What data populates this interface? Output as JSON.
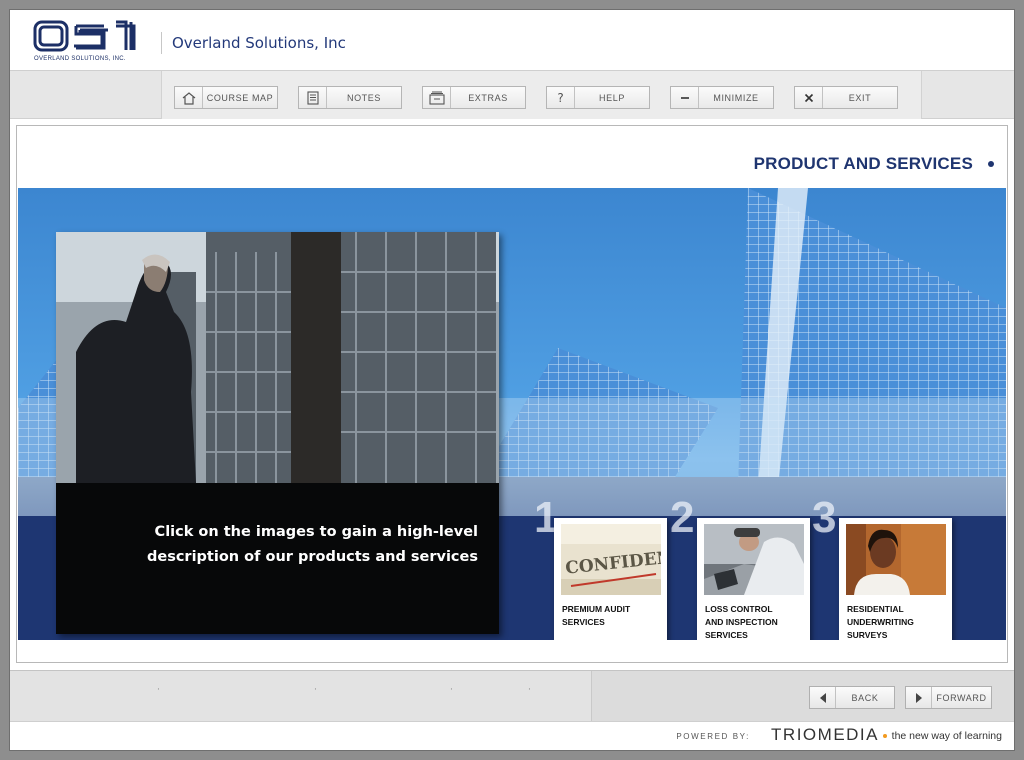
{
  "header": {
    "logo_text": "OSI",
    "logo_subtitle": "OVERLAND SOLUTIONS, INC.",
    "company_name": "Overland Solutions, Inc"
  },
  "toolbar": {
    "course_map": "COURSE MAP",
    "notes": "NOTES",
    "extras": "EXTRAS",
    "help": "HELP",
    "minimize": "MINIMIZE",
    "exit": "EXIT"
  },
  "main": {
    "section_title": "PRODUCT AND SERVICES",
    "intro_line1": "Click on the images to gain a high-level",
    "intro_line2": "description of our products and services",
    "cards": [
      {
        "number": "1",
        "line1": "PREMIUM AUDIT",
        "line2": "SERVICES",
        "line3": "",
        "image_text": "CONFIDEN"
      },
      {
        "number": "2",
        "line1": "LOSS CONTROL",
        "line2": "AND INSPECTION",
        "line3": "SERVICES"
      },
      {
        "number": "3",
        "line1": "RESIDENTIAL",
        "line2": "UNDERWRITING",
        "line3": "SURVEYS"
      }
    ]
  },
  "footer": {
    "back": "BACK",
    "forward": "FORWARD",
    "powered_by": "POWERED BY:",
    "brand": "TRIOMEDIA",
    "tagline": "the new way of learning"
  },
  "colors": {
    "brand_navy": "#1f3570",
    "banner_blue": "#4f9ee2",
    "accent_orange": "#f29a1f"
  }
}
